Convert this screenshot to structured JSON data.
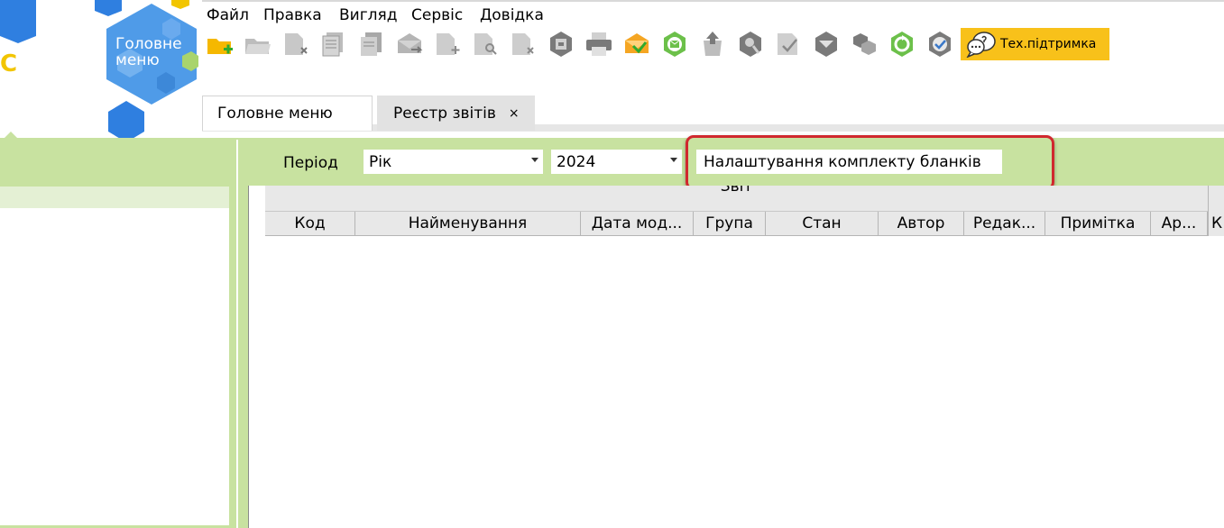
{
  "logo": {
    "letter": "C",
    "main_menu_label": "Головне\nменю"
  },
  "menubar": {
    "items": [
      "Файл",
      "Правка",
      "Вигляд",
      "Сервіс",
      "Довідка"
    ]
  },
  "toolbar": {
    "icons": [
      "new-folder-icon",
      "open-folder-icon",
      "delete-doc-icon",
      "copy-doc-icon",
      "duplicate-doc-icon",
      "send-envelope-icon",
      "add-doc-icon",
      "search-doc-icon",
      "remove-doc-icon",
      "archive-icon",
      "print-icon",
      "export-envelope-icon",
      "email-icon",
      "recycle-bin-icon",
      "find-icon",
      "check-doc-icon",
      "receive-icon",
      "group-icon",
      "refresh-icon",
      "verify-icon"
    ],
    "support_label": "Тех.підтримка"
  },
  "tabs": [
    {
      "label": "Головне меню"
    },
    {
      "label": "Реєстр звітів",
      "close": "×"
    }
  ],
  "filter": {
    "period_label": "Період",
    "period_type": "Рік",
    "year": "2024",
    "settings_label": "Налаштування комплекту бланків"
  },
  "table": {
    "group_header": "Звіт",
    "columns": [
      "Код",
      "Найменування",
      "Дата мод...",
      "Група",
      "Стан",
      "Автор",
      "Редак...",
      "Примітка",
      "Ар..."
    ],
    "right_stub": "К"
  }
}
